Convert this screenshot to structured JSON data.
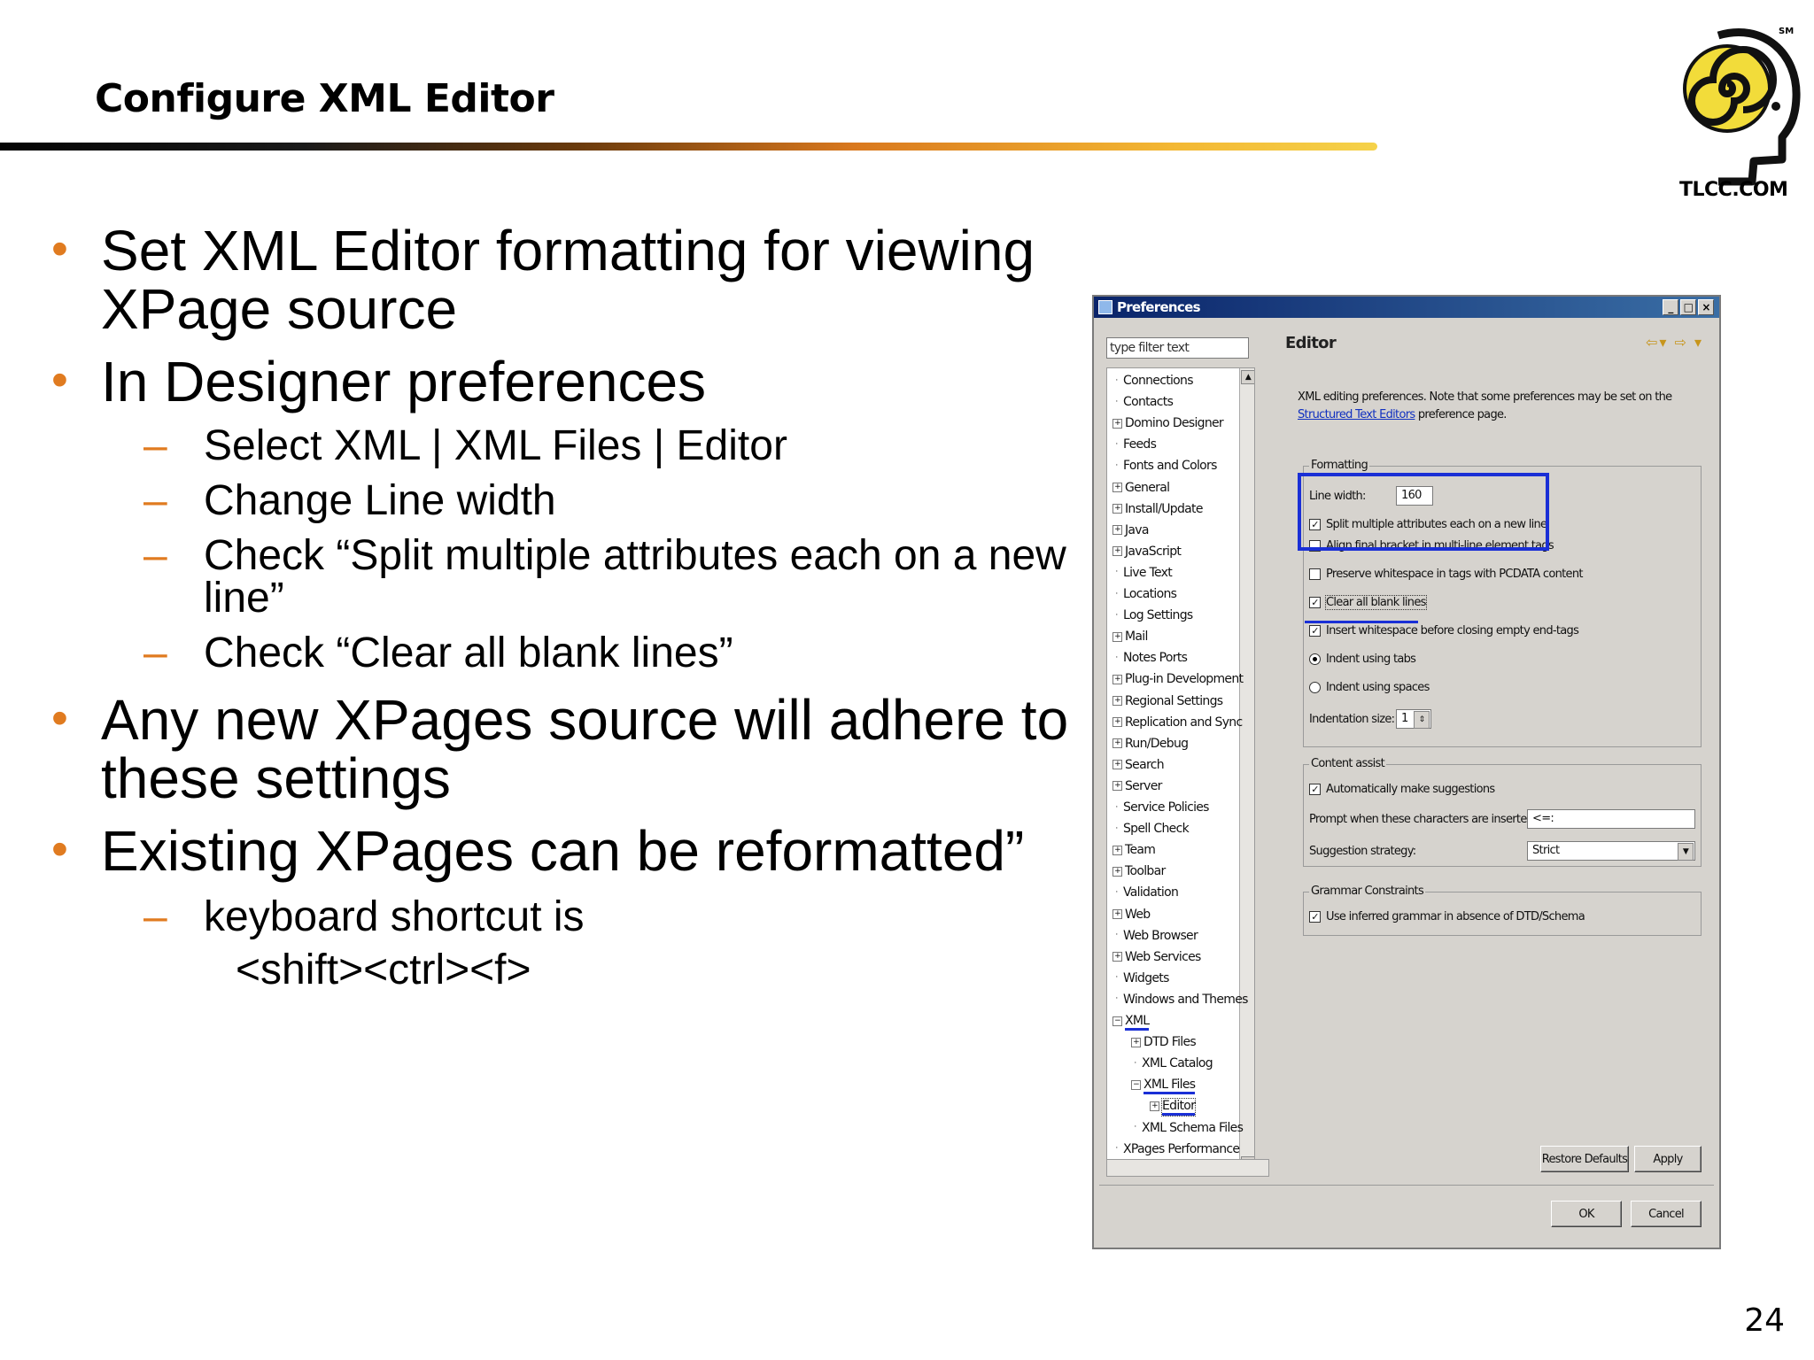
{
  "slide": {
    "title": "Configure XML Editor",
    "logo_text": "TLCC.COM",
    "page_number": "24",
    "bullets": [
      {
        "level": 1,
        "text": "Set XML Editor formatting for viewing XPage source"
      },
      {
        "level": 1,
        "text": "In Designer preferences"
      },
      {
        "level": 2,
        "text": "Select XML | XML Files | Editor"
      },
      {
        "level": 2,
        "text": "Change Line width"
      },
      {
        "level": 2,
        "text": "Check “Split multiple attributes each on a new line”"
      },
      {
        "level": 2,
        "text": "Check “Clear all blank lines”"
      },
      {
        "level": 1,
        "text": "Any new XPages source will adhere to these settings"
      },
      {
        "level": 1,
        "text": "Existing XPages can be reformatted”"
      },
      {
        "level": 2,
        "text": "keyboard shortcut is"
      },
      {
        "level": 3,
        "text": "<shift><ctrl><f>"
      }
    ],
    "accent_color": "#e07b20"
  },
  "dialog": {
    "title": "Preferences",
    "filter_placeholder": "type filter text",
    "tree": [
      {
        "label": "Connections",
        "depth": 0,
        "expandable": false
      },
      {
        "label": "Contacts",
        "depth": 0,
        "expandable": false
      },
      {
        "label": "Domino Designer",
        "depth": 0,
        "expandable": true
      },
      {
        "label": "Feeds",
        "depth": 0,
        "expandable": false
      },
      {
        "label": "Fonts and Colors",
        "depth": 0,
        "expandable": false
      },
      {
        "label": "General",
        "depth": 0,
        "expandable": true
      },
      {
        "label": "Install/Update",
        "depth": 0,
        "expandable": true
      },
      {
        "label": "Java",
        "depth": 0,
        "expandable": true
      },
      {
        "label": "JavaScript",
        "depth": 0,
        "expandable": true
      },
      {
        "label": "Live Text",
        "depth": 0,
        "expandable": false
      },
      {
        "label": "Locations",
        "depth": 0,
        "expandable": false
      },
      {
        "label": "Log Settings",
        "depth": 0,
        "expandable": false
      },
      {
        "label": "Mail",
        "depth": 0,
        "expandable": true
      },
      {
        "label": "Notes Ports",
        "depth": 0,
        "expandable": false
      },
      {
        "label": "Plug-in Development",
        "depth": 0,
        "expandable": true
      },
      {
        "label": "Regional Settings",
        "depth": 0,
        "expandable": true
      },
      {
        "label": "Replication and Sync",
        "depth": 0,
        "expandable": true
      },
      {
        "label": "Run/Debug",
        "depth": 0,
        "expandable": true
      },
      {
        "label": "Search",
        "depth": 0,
        "expandable": true
      },
      {
        "label": "Server",
        "depth": 0,
        "expandable": true
      },
      {
        "label": "Service Policies",
        "depth": 0,
        "expandable": false
      },
      {
        "label": "Spell Check",
        "depth": 0,
        "expandable": false
      },
      {
        "label": "Team",
        "depth": 0,
        "expandable": true
      },
      {
        "label": "Toolbar",
        "depth": 0,
        "expandable": true
      },
      {
        "label": "Validation",
        "depth": 0,
        "expandable": false
      },
      {
        "label": "Web",
        "depth": 0,
        "expandable": true
      },
      {
        "label": "Web Browser",
        "depth": 0,
        "expandable": false
      },
      {
        "label": "Web Services",
        "depth": 0,
        "expandable": true
      },
      {
        "label": "Widgets",
        "depth": 0,
        "expandable": false
      },
      {
        "label": "Windows and Themes",
        "depth": 0,
        "expandable": false
      },
      {
        "label": "XML",
        "depth": 0,
        "expandable": true,
        "expanded": true,
        "marked": true
      },
      {
        "label": "DTD Files",
        "depth": 1,
        "expandable": true
      },
      {
        "label": "XML Catalog",
        "depth": 1,
        "expandable": false
      },
      {
        "label": "XML Files",
        "depth": 1,
        "expandable": true,
        "expanded": true,
        "marked": true
      },
      {
        "label": "Editor",
        "depth": 2,
        "expandable": true,
        "selected": true,
        "marked": true
      },
      {
        "label": "XML Schema Files",
        "depth": 1,
        "expandable": false
      },
      {
        "label": "XPages Performance",
        "depth": 0,
        "expandable": false
      }
    ],
    "page_title": "Editor",
    "description_prefix": "XML editing preferences.  Note that some preferences may be set on the ",
    "description_link": "Structured Text Editors",
    "description_suffix": " preference page.",
    "formatting": {
      "legend": "Formatting",
      "line_width_label": "Line width:",
      "line_width_value": "160",
      "split_attrs": "Split multiple attributes each on a new line",
      "align_bracket": "Align final bracket in multi-line element tags",
      "preserve_ws": "Preserve whitespace in tags with PCDATA content",
      "clear_blank": "Clear all blank lines",
      "insert_ws": "Insert whitespace before closing empty end-tags",
      "indent_tabs": "Indent using tabs",
      "indent_spaces": "Indent using spaces",
      "indent_size_label": "Indentation size:",
      "indent_size_value": "1"
    },
    "content_assist": {
      "legend": "Content assist",
      "auto_suggest": "Automatically make suggestions",
      "prompt_label": "Prompt when these characters are inserted:",
      "prompt_value": "<=:",
      "strategy_label": "Suggestion strategy:",
      "strategy_value": "Strict"
    },
    "grammar": {
      "legend": "Grammar Constraints",
      "use_inferred": "Use inferred grammar in absence of DTD/Schema"
    },
    "buttons": {
      "restore": "Restore Defaults",
      "apply": "Apply",
      "ok": "OK",
      "cancel": "Cancel"
    },
    "highlight_color": "#1a2fd6"
  }
}
